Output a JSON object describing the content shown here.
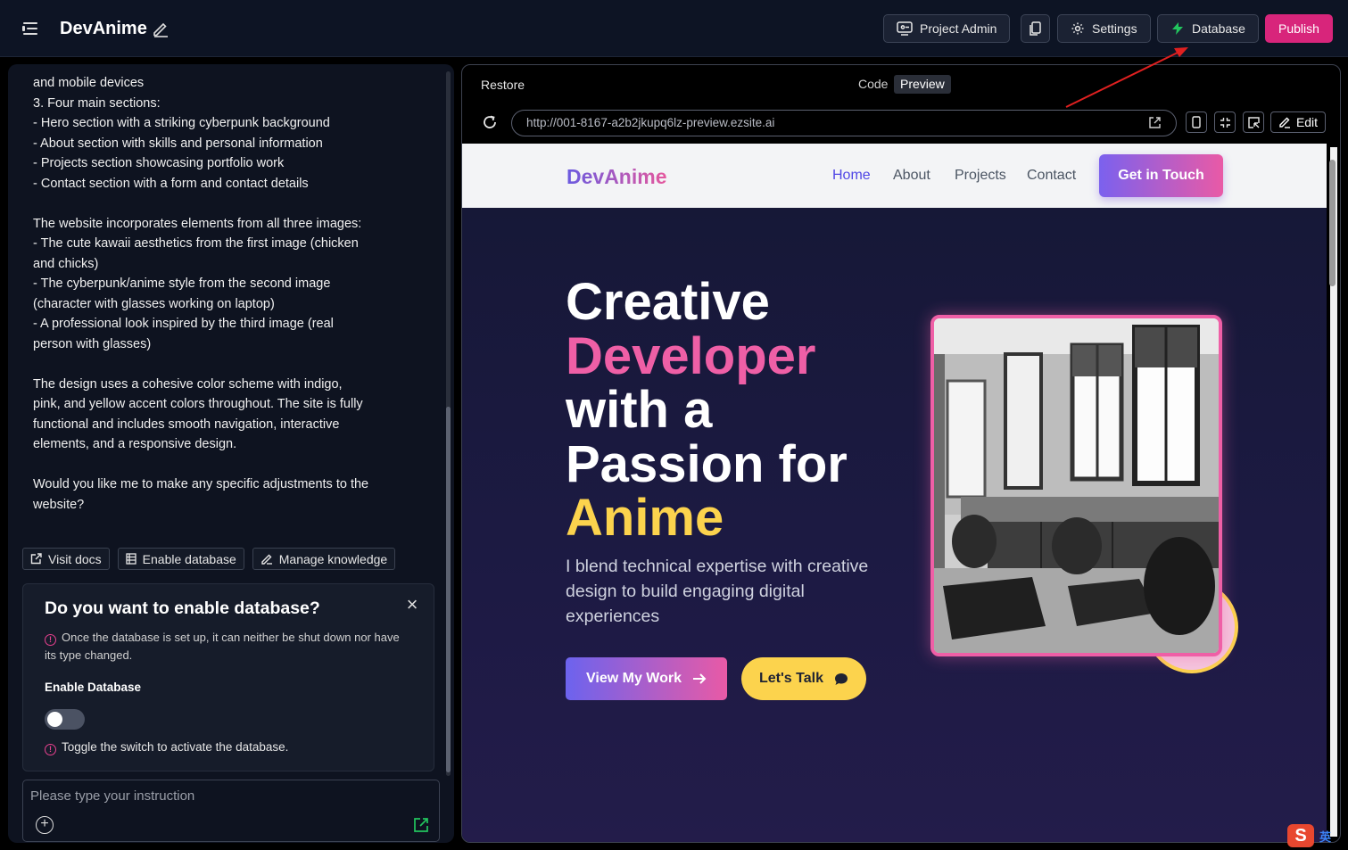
{
  "app": {
    "title": "DevAnime"
  },
  "toolbar": {
    "project_admin": "Project Admin",
    "settings": "Settings",
    "database": "Database",
    "publish": "Publish"
  },
  "chat": {
    "lines": [
      "and mobile devices",
      "3. Four main sections:",
      "- Hero section with a striking cyberpunk background",
      "- About section with skills and personal information",
      "- Projects section showcasing portfolio work",
      "- Contact section with a form and contact details",
      "",
      "The website incorporates elements from all three images:",
      "- The cute kawaii aesthetics from the first image (chicken and chicks)",
      "- The cyberpunk/anime style from the second image (character with glasses working on laptop)",
      "- A professional look inspired by the third image (real person with glasses)",
      "",
      "The design uses a cohesive color scheme with indigo, pink, and yellow accent colors throughout. The site is fully functional and includes smooth navigation, interactive elements, and a responsive design.",
      "",
      "Would you like me to make any specific adjustments to the website?"
    ],
    "actions": {
      "visit_docs": "Visit docs",
      "enable_database": "Enable database",
      "manage_knowledge": "Manage knowledge"
    },
    "db_card": {
      "title": "Do you want to enable database?",
      "warning": "Once the database is set up, it can neither be shut down nor have its type changed.",
      "label": "Enable Database",
      "hint": "Toggle the switch to activate the database."
    },
    "input": {
      "placeholder": "Please type your instruction"
    }
  },
  "preview_panel": {
    "restore": "Restore",
    "tab_code": "Code",
    "tab_preview": "Preview",
    "url": "http://001-8167-a2b2jkupq6lz-preview.ezsite.ai",
    "edit": "Edit"
  },
  "site": {
    "logo": "DevAnime",
    "nav": [
      "Home",
      "About",
      "Projects",
      "Contact"
    ],
    "cta": "Get in Touch",
    "hero": {
      "line1": "Creative",
      "line2": "Developer",
      "line3": "with a",
      "line4": "Passion for",
      "line5": "Anime",
      "paragraph": "I blend technical expertise with creative design to build engaging digital experiences",
      "btn_work": "View My Work",
      "btn_talk": "Let's Talk"
    }
  },
  "system": {
    "ime_label": "英"
  },
  "colors": {
    "publish": "#d8257b",
    "accent_indigo": "#4f46e5",
    "accent_pink": "#ef5fa6",
    "accent_yellow": "#fcd34d",
    "database_icon": "#22c55e"
  }
}
